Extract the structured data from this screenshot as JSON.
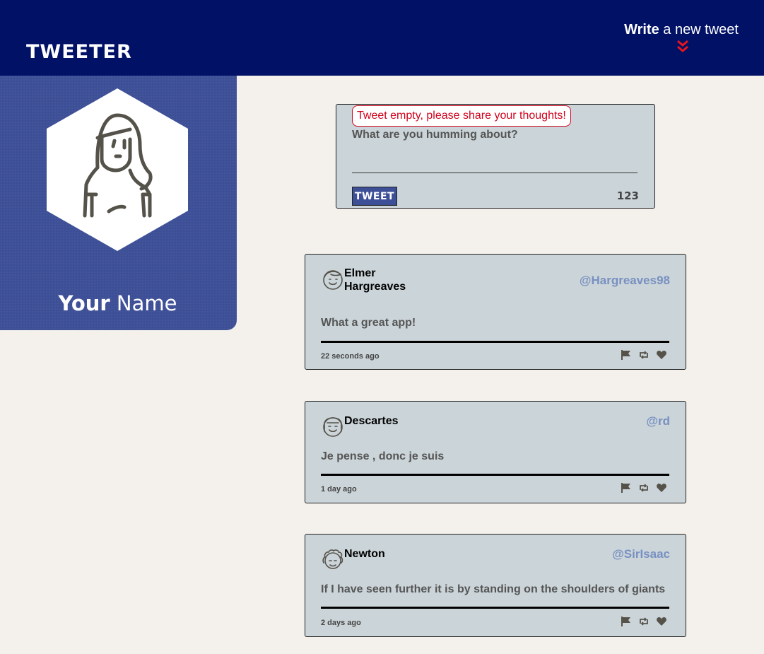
{
  "navbar": {
    "brand": "TWEETER",
    "compose_bold": "Write",
    "compose_rest": " a new tweet",
    "chevron_icon": "double-chevron-down-icon",
    "chevron_color": "#e8151b",
    "background": "#001166"
  },
  "profile": {
    "first_name": "Your",
    "last_name": " Name",
    "avatar_icon": "woman-avatar-icon",
    "background": "#3d4f96"
  },
  "composer": {
    "error": "Tweet empty, please share your thoughts!",
    "placeholder": "What are you humming about?",
    "value": "",
    "submit_label": "TWEET",
    "char_count": "123"
  },
  "tweets": [
    {
      "author": "Elmer Hargreaves",
      "handle": "@Hargreaves98",
      "content": "What a great app!",
      "timestamp": "22 seconds ago",
      "avatar_icon": "man-avatar-icon"
    },
    {
      "author": "Descartes",
      "handle": "@rd",
      "content": "Je pense , donc je suis",
      "timestamp": "1 day ago",
      "avatar_icon": "long-hair-avatar-icon"
    },
    {
      "author": "Newton",
      "handle": "@SirIsaac",
      "content": "If I have seen further it is by standing on the shoulders of giants",
      "timestamp": "2 days ago",
      "avatar_icon": "curly-hair-avatar-icon"
    }
  ],
  "actions": {
    "flag_icon": "flag-icon",
    "retweet_icon": "retweet-icon",
    "like_icon": "heart-icon"
  },
  "colors": {
    "card": "#cbd4d8",
    "handle": "#7890c2",
    "error": "#d0021b",
    "page": "#f4f1ec"
  }
}
